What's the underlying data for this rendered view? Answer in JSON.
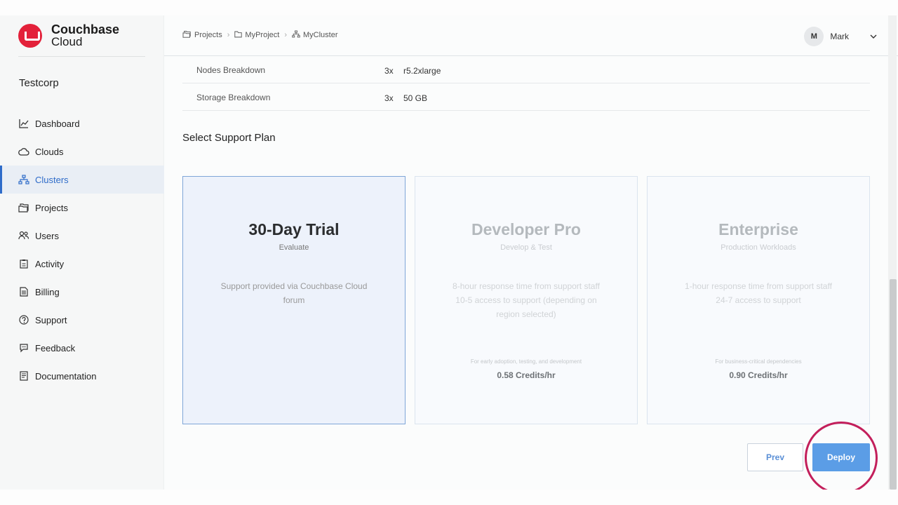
{
  "brand": {
    "name_line1": "Couchbase",
    "name_line2": "Cloud",
    "logo_color": "#e3213a"
  },
  "org": "Testcorp",
  "sidebar": {
    "items": [
      {
        "label": "Dashboard",
        "icon": "chart-line-icon"
      },
      {
        "label": "Clouds",
        "icon": "cloud-icon"
      },
      {
        "label": "Clusters",
        "icon": "cluster-icon",
        "active": true
      },
      {
        "label": "Projects",
        "icon": "folders-icon"
      },
      {
        "label": "Users",
        "icon": "users-icon"
      },
      {
        "label": "Activity",
        "icon": "clipboard-icon"
      },
      {
        "label": "Billing",
        "icon": "receipt-icon"
      },
      {
        "label": "Support",
        "icon": "help-circle-icon"
      },
      {
        "label": "Feedback",
        "icon": "chat-bubble-icon"
      },
      {
        "label": "Documentation",
        "icon": "book-icon"
      }
    ]
  },
  "breadcrumb": [
    {
      "label": "Projects",
      "icon": "folders-icon"
    },
    {
      "label": "MyProject",
      "icon": "folder-icon"
    },
    {
      "label": "MyCluster",
      "icon": "cluster-icon"
    }
  ],
  "user": {
    "initial": "M",
    "name": "Mark"
  },
  "summary": [
    {
      "label": "Nodes Breakdown",
      "qty": "3x",
      "value": "r5.2xlarge"
    },
    {
      "label": "Storage Breakdown",
      "qty": "3x",
      "value": "50 GB"
    }
  ],
  "section_title": "Select Support Plan",
  "plans": [
    {
      "name": "30-Day Trial",
      "subtitle": "Evaluate",
      "desc1": "Support provided via Couchbase Cloud forum",
      "desc2": "",
      "note": "",
      "price": "",
      "selected": true
    },
    {
      "name": "Developer Pro",
      "subtitle": "Develop & Test",
      "desc1": "8-hour response time from support staff",
      "desc2": "10-5 access to support (depending on region selected)",
      "note": "For early adoption, testing, and development",
      "price": "0.58 Credits/hr",
      "selected": false
    },
    {
      "name": "Enterprise",
      "subtitle": "Production Workloads",
      "desc1": "1-hour response time from support staff",
      "desc2": "24-7 access to support",
      "note": "For business-critical dependencies",
      "price": "0.90 Credits/hr",
      "selected": false
    }
  ],
  "buttons": {
    "prev": "Prev",
    "deploy": "Deploy"
  },
  "colors": {
    "accent": "#5b9de6",
    "active_nav": "#2f6cc9",
    "highlight_ring": "#c31f5b"
  }
}
